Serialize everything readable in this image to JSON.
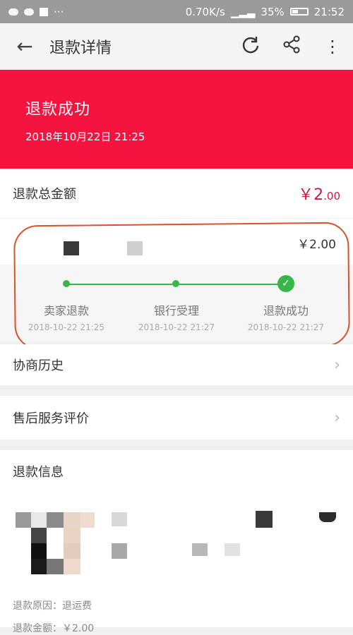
{
  "statusbar": {
    "network_speed": "0.70K/s",
    "battery": "35%",
    "time": "21:52"
  },
  "header": {
    "back_icon": "←",
    "title": "退款详情",
    "refresh_icon": "⟳",
    "share_icon": "<",
    "more_icon": "⋮"
  },
  "banner": {
    "status": "退款成功",
    "time": "2018年10月22日 21:25"
  },
  "total": {
    "label": "退款总金额",
    "currency": "￥",
    "amount_int": "2",
    "amount_dec": ".00"
  },
  "progress": {
    "price": "￥2.00",
    "steps": [
      {
        "label": "卖家退款",
        "time": "2018-10-22 21:25"
      },
      {
        "label": "银行受理",
        "time": "2018-10-22 21:27"
      },
      {
        "label": "退款成功",
        "time": "2018-10-22 21:27"
      }
    ]
  },
  "menu": {
    "history": "协商历史",
    "evaluation": "售后服务评价",
    "chevron": "›"
  },
  "refund_info": {
    "title": "退款信息",
    "reason": "退款原因：退运费",
    "amount": "退款金额：￥2.00"
  },
  "colors": {
    "banner": "#f5133f",
    "price": "#c91b45",
    "progress": "#39b54a",
    "annotation": "#d7512d"
  }
}
